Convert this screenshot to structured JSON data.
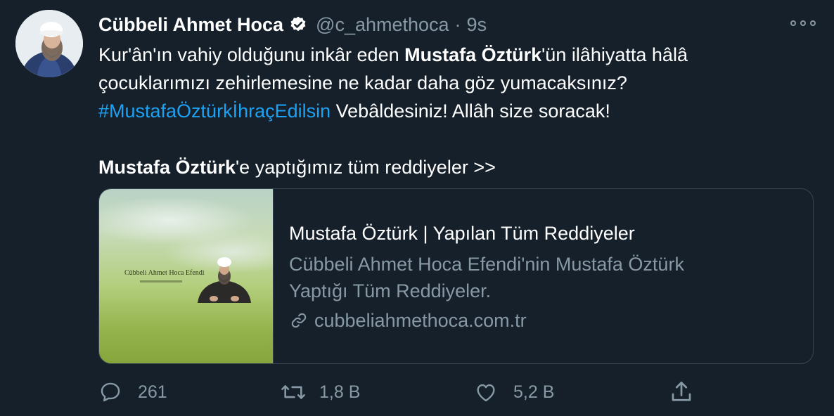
{
  "author": {
    "name": "Cübbeli Ahmet Hoca",
    "handle": "@c_ahmethoca",
    "separator": "·",
    "time": "9s"
  },
  "tweet": {
    "line1": {
      "a": "Kur'ân'ın vahiy olduğunu inkâr eden ",
      "b": "Mustafa Öztürk",
      "c": "'ün ilâhiyatta hâlâ"
    },
    "line2": "çocuklarımızı zehirlemesine ne kadar daha göz yumacaksınız?",
    "line3": {
      "hashtag": "#MustafaÖztürkİhraçEdilsin",
      "rest": " Vebâldesiniz! Allâh size soracak!"
    },
    "line5": {
      "bold": "Mustafa Öztürk",
      "rest": "'e yaptığımız tüm reddiyeler >>"
    }
  },
  "card": {
    "image_title": "Cübbeli Ahmet Hoca Efendi",
    "title": "Mustafa Öztürk | Yapılan Tüm Reddiyeler",
    "description": "Cübbeli Ahmet Hoca Efendi'nin Mustafa Öztürk Yaptığı Tüm Reddiyeler.",
    "link": "cubbeliahmethoca.com.tr"
  },
  "actions": {
    "reply_count": "261",
    "retweet_count": "1,8 B",
    "like_count": "5,2 B"
  },
  "icons": {
    "verified": "verified-badge-icon",
    "more": "more-options-icon",
    "reply": "reply-icon",
    "retweet": "retweet-icon",
    "like": "heart-icon",
    "share": "share-icon",
    "link": "link-icon"
  },
  "colors": {
    "background": "#15202b",
    "text": "#ffffff",
    "secondary": "#8899a6",
    "accent": "#1da1f2",
    "border": "#38444d"
  }
}
